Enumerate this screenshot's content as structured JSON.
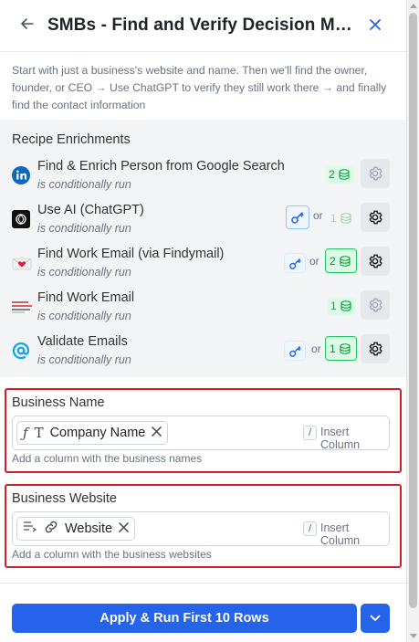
{
  "header": {
    "title": "SMBs - Find and Verify Decision Mak...",
    "back_icon": "arrow-left-icon",
    "close_icon": "close-icon"
  },
  "description": "Start with just a business's website and name. Then we'll find the owner, founder, or CEO → Use ChatGPT to verify they still work there → and finally find the contact information",
  "recipes": {
    "title": "Recipe Enrichments",
    "items": [
      {
        "name": "Find & Enrich Person from Google Search",
        "sub": "is conditionally run",
        "icon": "linkedin-icon",
        "credit": "2",
        "or": ""
      },
      {
        "name": "Use AI (ChatGPT)",
        "sub": "is conditionally run",
        "icon": "openai-icon",
        "credit": "1",
        "or": "or"
      },
      {
        "name": "Find Work Email (via Findymail)",
        "sub": "is conditionally run",
        "icon": "findymail-icon",
        "credit": "2",
        "or": "or"
      },
      {
        "name": "Find Work Email",
        "sub": "is conditionally run",
        "icon": "lines-icon",
        "credit": "1",
        "or": ""
      },
      {
        "name": "Validate Emails",
        "sub": "is conditionally run",
        "icon": "at-icon",
        "credit": "1",
        "or": "or"
      }
    ]
  },
  "business_name": {
    "label": "Business Name",
    "chip": "Company Name",
    "insert": "Insert Column",
    "slash": "/",
    "hint": "Add a column with the business names"
  },
  "business_website": {
    "label": "Business Website",
    "chip": "Website",
    "insert": "Insert Column",
    "slash": "/",
    "hint": "Add a column with the business websites"
  },
  "footer": {
    "run_label": "Apply & Run First 10 Rows"
  },
  "colors": {
    "accent": "#2563eb",
    "highlight": "#d11f2a",
    "credit_green": "#22c55e"
  }
}
